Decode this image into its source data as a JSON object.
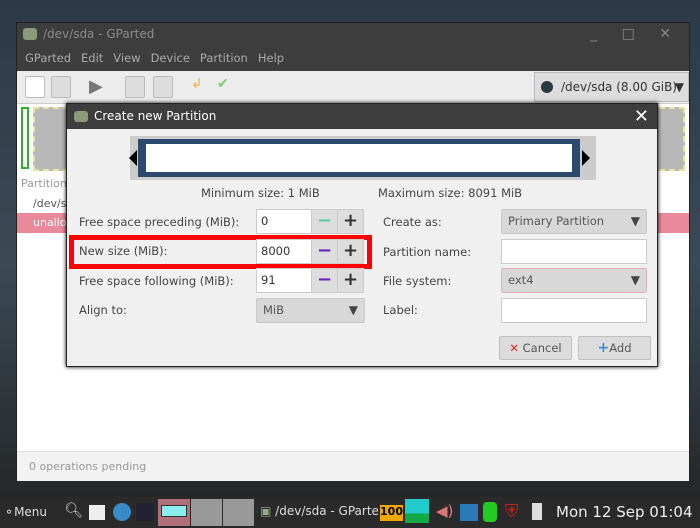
{
  "window": {
    "title": "/dev/sda - GParted",
    "controls": "_ □ ✕"
  },
  "menu": [
    "GParted",
    "Edit",
    "View",
    "Device",
    "Partition",
    "Help"
  ],
  "device_selector": "/dev/sda (8.00 GiB)",
  "list": {
    "header": "Partition",
    "rows": [
      "/dev/sda",
      "unallocated"
    ]
  },
  "status": "0 operations pending",
  "dialog": {
    "title": "Create new Partition",
    "min_size": "Minimum size: 1 MiB",
    "max_size": "Maximum size: 8091 MiB",
    "free_preceding_label": "Free space preceding (MiB):",
    "free_preceding_value": "0",
    "new_size_label": "New size (MiB):",
    "new_size_value": "8000",
    "free_following_label": "Free space following (MiB):",
    "free_following_value": "91",
    "align_label": "Align to:",
    "align_value": "MiB",
    "create_as_label": "Create as:",
    "create_as_value": "Primary Partition",
    "partition_name_label": "Partition name:",
    "file_system_label": "File system:",
    "file_system_value": "ext4",
    "label_label": "Label:",
    "cancel": "Cancel",
    "add": "Add",
    "minus": "−",
    "plus": "+"
  },
  "taskbar": {
    "menu": "Menu",
    "task": "/dev/sda - GParted",
    "battery": "100",
    "clock": "Mon 12 Sep 01:04"
  },
  "colors": {
    "highlight": "#ff0000",
    "unallocated": "#e88a9a",
    "slider_frame": "#2c4a6e"
  }
}
